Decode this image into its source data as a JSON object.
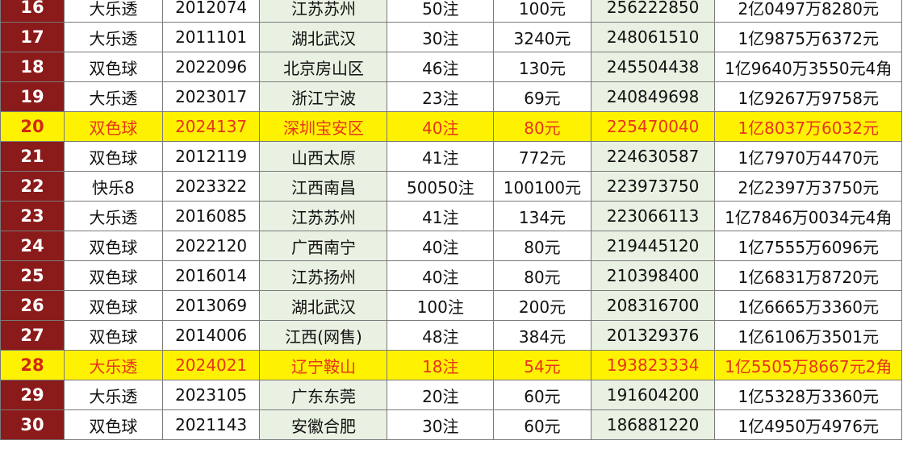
{
  "highlight_colors": {
    "rank_bg": "#8b1a1a",
    "highlight_row_bg": "#fff200",
    "highlight_row_text": "#e8341c",
    "green_column_bg": "#e9f1e2"
  },
  "rows": [
    {
      "rank": "16",
      "game": "大乐透",
      "issue": "2012074",
      "place": "江苏苏州",
      "notes": "50注",
      "prize": "100元",
      "sales": "256222850",
      "total": "2亿0497万8280元",
      "highlight": false
    },
    {
      "rank": "17",
      "game": "大乐透",
      "issue": "2011101",
      "place": "湖北武汉",
      "notes": "30注",
      "prize": "3240元",
      "sales": "248061510",
      "total": "1亿9875万6372元",
      "highlight": false
    },
    {
      "rank": "18",
      "game": "双色球",
      "issue": "2022096",
      "place": "北京房山区",
      "notes": "46注",
      "prize": "130元",
      "sales": "245504438",
      "total": "1亿9640万3550元4角",
      "highlight": false
    },
    {
      "rank": "19",
      "game": "大乐透",
      "issue": "2023017",
      "place": "浙江宁波",
      "notes": "23注",
      "prize": "69元",
      "sales": "240849698",
      "total": "1亿9267万9758元",
      "highlight": false
    },
    {
      "rank": "20",
      "game": "双色球",
      "issue": "2024137",
      "place": "深圳宝安区",
      "notes": "40注",
      "prize": "80元",
      "sales": "225470040",
      "total": "1亿8037万6032元",
      "highlight": true
    },
    {
      "rank": "21",
      "game": "双色球",
      "issue": "2012119",
      "place": "山西太原",
      "notes": "41注",
      "prize": "772元",
      "sales": "224630587",
      "total": "1亿7970万4470元",
      "highlight": false
    },
    {
      "rank": "22",
      "game": "快乐8",
      "issue": "2023322",
      "place": "江西南昌",
      "notes": "50050注",
      "prize": "100100元",
      "sales": "223973750",
      "total": "2亿2397万3750元",
      "highlight": false
    },
    {
      "rank": "23",
      "game": "大乐透",
      "issue": "2016085",
      "place": "江苏苏州",
      "notes": "41注",
      "prize": "134元",
      "sales": "223066113",
      "total": "1亿7846万0034元4角",
      "highlight": false
    },
    {
      "rank": "24",
      "game": "双色球",
      "issue": "2022120",
      "place": "广西南宁",
      "notes": "40注",
      "prize": "80元",
      "sales": "219445120",
      "total": "1亿7555万6096元",
      "highlight": false
    },
    {
      "rank": "25",
      "game": "双色球",
      "issue": "2016014",
      "place": "江苏扬州",
      "notes": "40注",
      "prize": "80元",
      "sales": "210398400",
      "total": "1亿6831万8720元",
      "highlight": false
    },
    {
      "rank": "26",
      "game": "双色球",
      "issue": "2013069",
      "place": "湖北武汉",
      "notes": "100注",
      "prize": "200元",
      "sales": "208316700",
      "total": "1亿6665万3360元",
      "highlight": false
    },
    {
      "rank": "27",
      "game": "双色球",
      "issue": "2014006",
      "place": "江西(网售)",
      "notes": "48注",
      "prize": "384元",
      "sales": "201329376",
      "total": "1亿6106万3501元",
      "highlight": false
    },
    {
      "rank": "28",
      "game": "大乐透",
      "issue": "2024021",
      "place": "辽宁鞍山",
      "notes": "18注",
      "prize": "54元",
      "sales": "193823334",
      "total": "1亿5505万8667元2角",
      "highlight": true
    },
    {
      "rank": "29",
      "game": "大乐透",
      "issue": "2023105",
      "place": "广东东莞",
      "notes": "20注",
      "prize": "60元",
      "sales": "191604200",
      "total": "1亿5328万3360元",
      "highlight": false
    },
    {
      "rank": "30",
      "game": "双色球",
      "issue": "2021143",
      "place": "安徽合肥",
      "notes": "30注",
      "prize": "60元",
      "sales": "186881220",
      "total": "1亿4950万4976元",
      "highlight": false
    }
  ]
}
